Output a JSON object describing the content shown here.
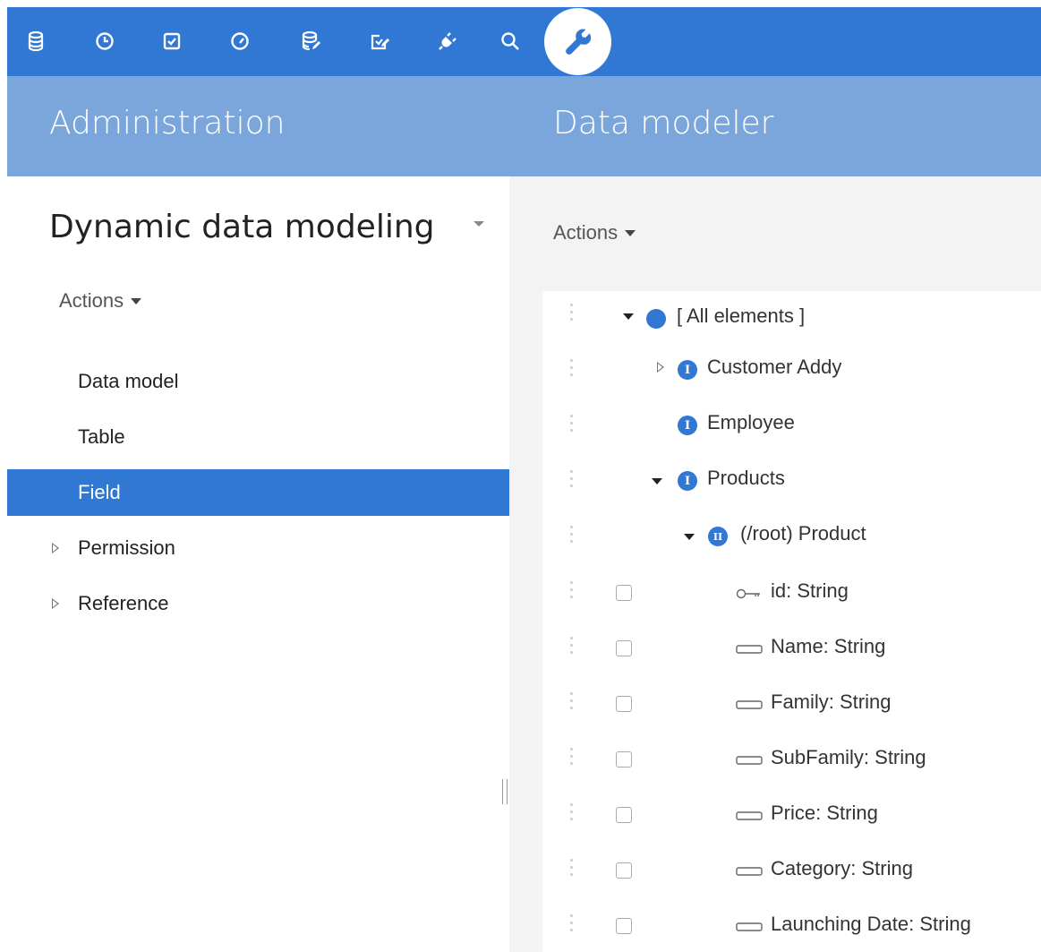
{
  "toolbar": {
    "icons": [
      "database-icon",
      "clock-icon",
      "checkbox-icon",
      "gauge-icon",
      "database-edit-icon",
      "checkbox-edit-icon",
      "plug-icon",
      "search-icon"
    ],
    "active_icon": "wrench-icon",
    "color": "#3177d4"
  },
  "header": {
    "left_title": "Administration",
    "right_title": "Data modeler",
    "color": "#7aa6dc"
  },
  "left_panel": {
    "title": "Dynamic data modeling",
    "actions_label": "Actions",
    "nav": [
      {
        "label": "Data model",
        "expandable": false,
        "active": false
      },
      {
        "label": "Table",
        "expandable": false,
        "active": false
      },
      {
        "label": "Field",
        "expandable": false,
        "active": true
      },
      {
        "label": "Permission",
        "expandable": true,
        "active": false
      },
      {
        "label": "Reference",
        "expandable": true,
        "active": false
      }
    ]
  },
  "right_panel": {
    "actions_label": "Actions",
    "tree": [
      {
        "label": "[ All elements ]",
        "icon": "dot-icon",
        "expander": "expanded",
        "checkbox": false
      },
      {
        "label": "Customer Addy",
        "icon": "badge-I-icon",
        "badge": "I",
        "expander": "collapsed",
        "checkbox": false
      },
      {
        "label": "Employee",
        "icon": "badge-I-icon",
        "badge": "I",
        "expander": "none",
        "checkbox": false
      },
      {
        "label": "Products",
        "icon": "badge-I-icon",
        "badge": "I",
        "expander": "expanded",
        "checkbox": false
      },
      {
        "label": "(/root) Product",
        "icon": "badge-II-icon",
        "badge": "II",
        "expander": "expanded",
        "checkbox": false
      },
      {
        "label": "id: String",
        "icon": "key-field-icon",
        "expander": "none",
        "checkbox": true
      },
      {
        "label": "Name: String",
        "icon": "field-icon",
        "expander": "none",
        "checkbox": true
      },
      {
        "label": "Family: String",
        "icon": "field-icon",
        "expander": "none",
        "checkbox": true
      },
      {
        "label": "SubFamily: String",
        "icon": "field-icon",
        "expander": "none",
        "checkbox": true
      },
      {
        "label": "Price: String",
        "icon": "field-icon",
        "expander": "none",
        "checkbox": true
      },
      {
        "label": "Category: String",
        "icon": "field-icon",
        "expander": "none",
        "checkbox": true
      },
      {
        "label": "Launching Date: String",
        "icon": "field-icon",
        "expander": "none",
        "checkbox": true
      }
    ]
  }
}
